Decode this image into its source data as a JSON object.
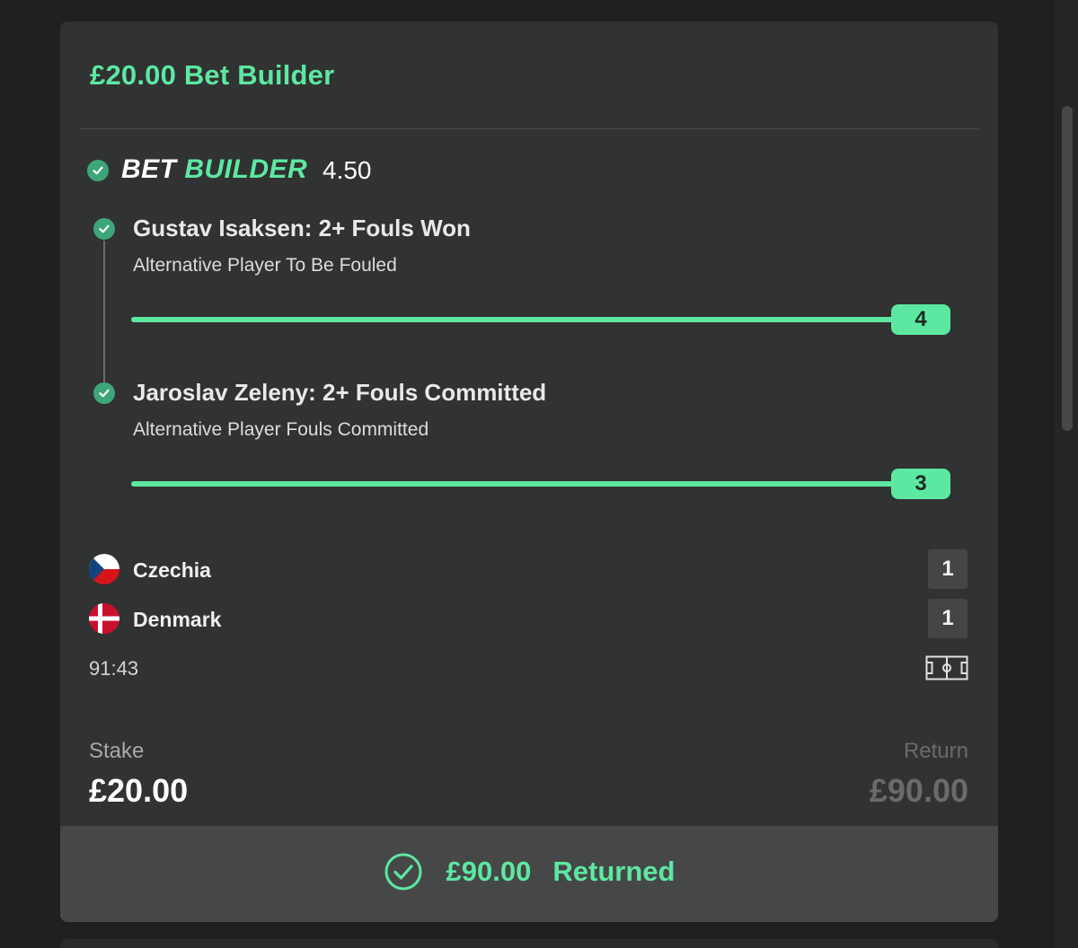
{
  "card": {
    "title": "£20.00 Bet Builder",
    "bet_builder": {
      "label_part1": "BET",
      "label_part2": "BUILDER",
      "odds": "4.50"
    },
    "legs": [
      {
        "title": "Gustav Isaksen: 2+ Fouls Won",
        "market": "Alternative Player To Be Fouled",
        "progress_value": "4",
        "progress_fraction": 1.0,
        "status": "won"
      },
      {
        "title": "Jaroslav Zeleny: 2+ Fouls Committed",
        "market": "Alternative Player Fouls Committed",
        "progress_value": "3",
        "progress_fraction": 1.0,
        "status": "won"
      }
    ],
    "match": {
      "teams": [
        {
          "name": "Czechia",
          "score": "1",
          "flag": "czech-flag-icon"
        },
        {
          "name": "Denmark",
          "score": "1",
          "flag": "denmark-flag-icon"
        }
      ],
      "clock": "91:43",
      "pitch_icon": "pitch-icon"
    },
    "stake": {
      "label": "Stake",
      "value": "£20.00"
    },
    "return": {
      "label": "Return",
      "value": "£90.00"
    },
    "footer": {
      "amount": "£90.00",
      "status": "Returned",
      "icon": "check-circle-icon"
    }
  },
  "colors": {
    "accent": "#5de8a2",
    "card_bg": "#313232",
    "page_bg": "#1f2020",
    "footer_bg": "#464848",
    "check_green": "#3da679"
  }
}
